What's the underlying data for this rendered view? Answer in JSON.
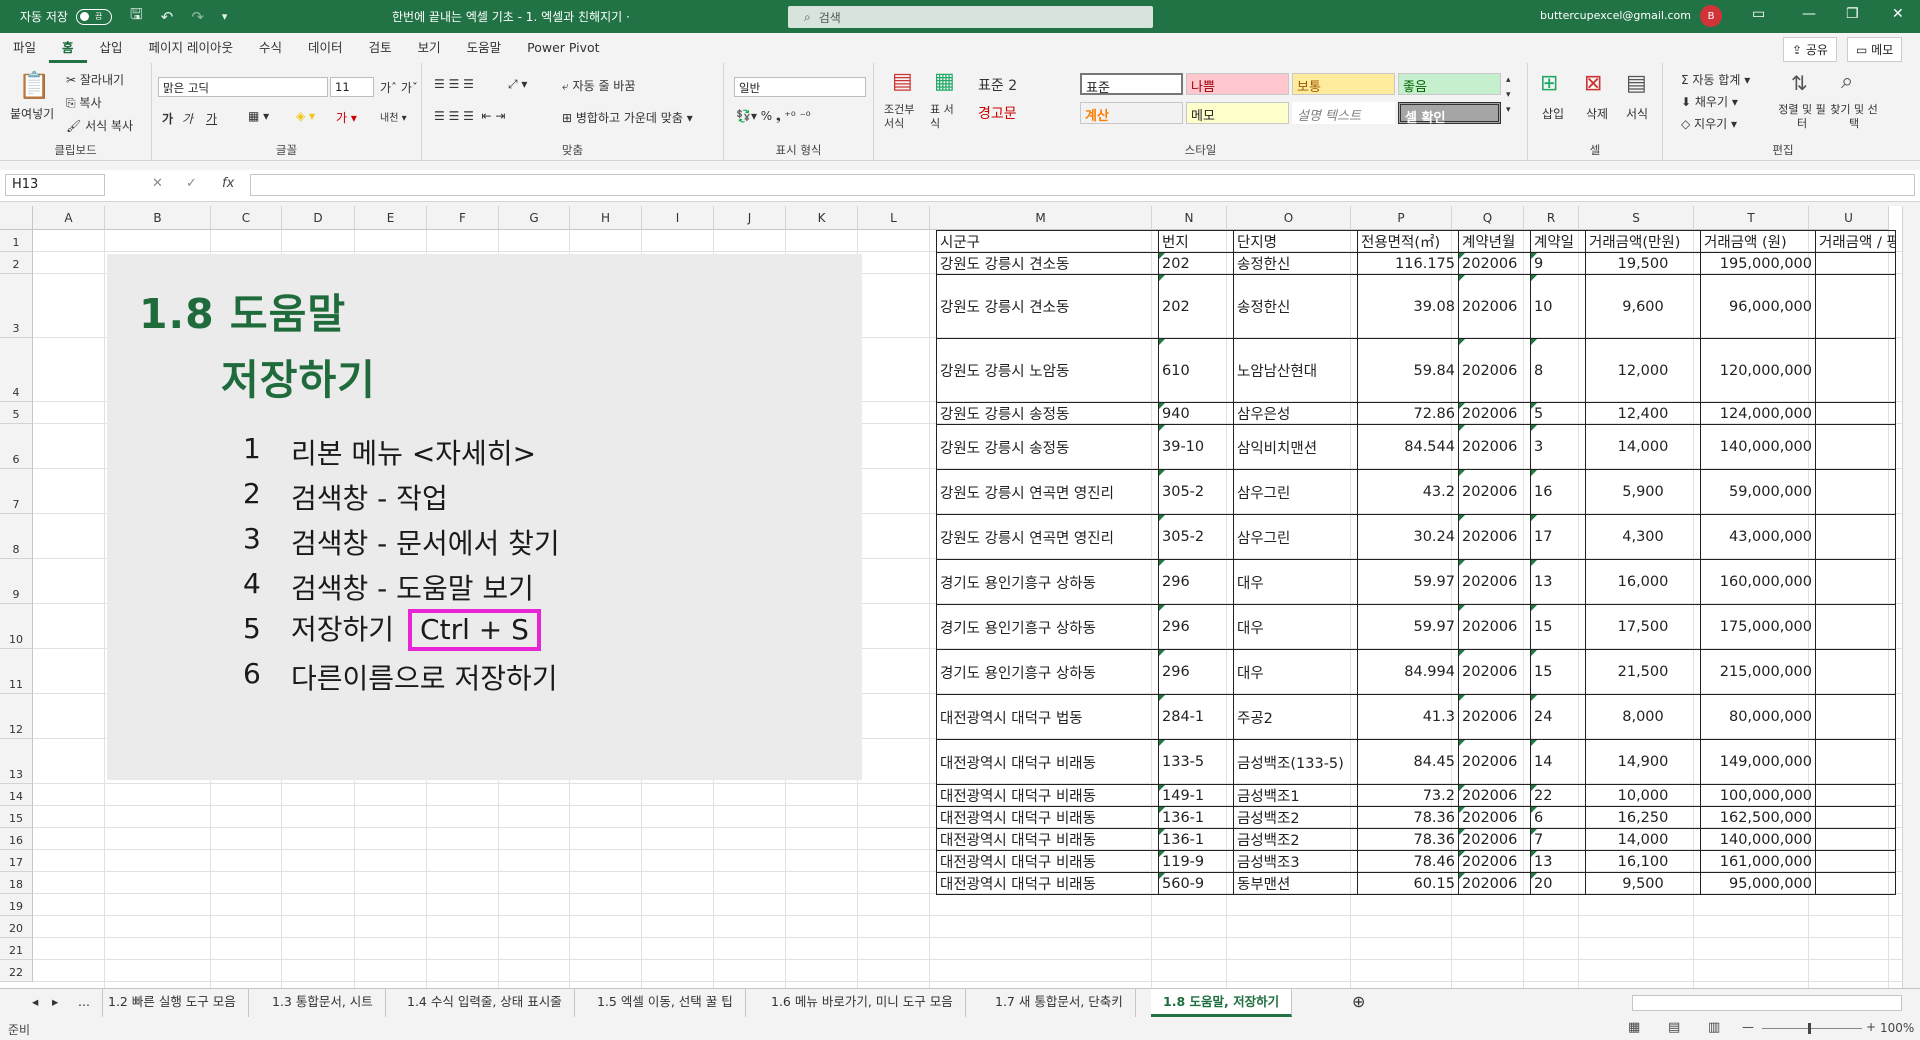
{
  "titlebar": {
    "autosave": "자동 저장",
    "toggle": "끔",
    "doc_title": "한번에 끝내는 엑셀 기초 - 1. 엑셀과 친해지기 ·",
    "search": "검색",
    "user": "buttercupexcel@gmail.com",
    "avatar": "B"
  },
  "tabs": [
    "파일",
    "홈",
    "삽입",
    "페이지 레이아웃",
    "수식",
    "데이터",
    "검토",
    "보기",
    "도움말",
    "Power Pivot"
  ],
  "share": "공유",
  "memo": "메모",
  "ribbon": {
    "paste": "붙여넣기",
    "cut": "잘라내기",
    "copy": "복사",
    "format_painter": "서식 복사",
    "clipboard": "클립보드",
    "font_name": "맑은 고딕",
    "font_size": "11",
    "font": "글꼴",
    "wrap": "자동 줄 바꿈",
    "merge": "병합하고 가운데 맞춤",
    "align": "맞춤",
    "number_format": "일반",
    "number": "표시 형식",
    "cond_format": "조건부 서식",
    "table_format": "표 서식",
    "styles": {
      "normal2": "표준 2",
      "warn": "경고문",
      "normal": "표준",
      "bad": "나쁨",
      "neutral": "보통",
      "good": "좋음",
      "calc": "계산",
      "note": "메모",
      "explain": "설명 텍스트",
      "check": "셀 확인"
    },
    "style": "스타일",
    "insert": "삽입",
    "delete": "삭제",
    "format": "서식",
    "cells": "셀",
    "autosum": "자동 합계",
    "fill": "채우기",
    "clear": "지우기",
    "sort": "정렬 및 필터",
    "find": "찾기 및 선택",
    "edit": "편집"
  },
  "namebox": "H13",
  "columns": [
    "A",
    "B",
    "C",
    "D",
    "E",
    "F",
    "G",
    "H",
    "I",
    "J",
    "K",
    "L",
    "M",
    "N",
    "O",
    "P",
    "Q",
    "R",
    "S",
    "T",
    "U"
  ],
  "rows": [
    "1",
    "2",
    "3",
    "4",
    "5",
    "6",
    "7",
    "8",
    "9",
    "10",
    "11",
    "12",
    "13",
    "14",
    "15",
    "16",
    "17",
    "18",
    "19",
    "20",
    "21",
    "22"
  ],
  "panel": {
    "title1": "1.8 도움말",
    "title2": "저장하기",
    "items": [
      {
        "n": "1",
        "t": "리본 메뉴 <자세히>"
      },
      {
        "n": "2",
        "t": "검색창 - 작업"
      },
      {
        "n": "3",
        "t": "검색창 - 문서에서 찾기"
      },
      {
        "n": "4",
        "t": "검색창 - 도움말 보기"
      },
      {
        "n": "5",
        "t": "저장하기"
      },
      {
        "n": "6",
        "t": "다른이름으로 저장하기"
      }
    ],
    "shortcut": "Ctrl + S"
  },
  "table": {
    "headers": [
      "시군구",
      "번지",
      "단지명",
      "전용면적(㎡)",
      "계약년월",
      "계약일",
      "거래금액(만원)",
      "거래금액 (원)",
      "거래금액 / 평"
    ],
    "rows": [
      [
        "강원도 강릉시 견소동",
        "202",
        "송정한신",
        "116.175",
        "202006",
        "9",
        "19,500",
        "195,000,000"
      ],
      [
        "강원도 강릉시 견소동",
        "202",
        "송정한신",
        "39.08",
        "202006",
        "10",
        "9,600",
        "96,000,000"
      ],
      [
        "강원도 강릉시 노암동",
        "610",
        "노암남산현대",
        "59.84",
        "202006",
        "8",
        "12,000",
        "120,000,000"
      ],
      [
        "강원도 강릉시 송정동",
        "940",
        "삼우은성",
        "72.86",
        "202006",
        "5",
        "12,400",
        "124,000,000"
      ],
      [
        "강원도 강릉시 송정동",
        "39-10",
        "삼익비치맨션",
        "84.544",
        "202006",
        "3",
        "14,000",
        "140,000,000"
      ],
      [
        "강원도 강릉시 연곡면 영진리",
        "305-2",
        "삼우그린",
        "43.2",
        "202006",
        "16",
        "5,900",
        "59,000,000"
      ],
      [
        "강원도 강릉시 연곡면 영진리",
        "305-2",
        "삼우그린",
        "30.24",
        "202006",
        "17",
        "4,300",
        "43,000,000"
      ],
      [
        "경기도 용인기흥구 상하동",
        "296",
        "대우",
        "59.97",
        "202006",
        "13",
        "16,000",
        "160,000,000"
      ],
      [
        "경기도 용인기흥구 상하동",
        "296",
        "대우",
        "59.97",
        "202006",
        "15",
        "17,500",
        "175,000,000"
      ],
      [
        "경기도 용인기흥구 상하동",
        "296",
        "대우",
        "84.994",
        "202006",
        "15",
        "21,500",
        "215,000,000"
      ],
      [
        "대전광역시 대덕구 법동",
        "284-1",
        "주공2",
        "41.3",
        "202006",
        "24",
        "8,000",
        "80,000,000"
      ],
      [
        "대전광역시 대덕구 비래동",
        "133-5",
        "금성백조(133-5)",
        "84.45",
        "202006",
        "14",
        "14,900",
        "149,000,000"
      ],
      [
        "대전광역시 대덕구 비래동",
        "149-1",
        "금성백조1",
        "73.2",
        "202006",
        "22",
        "10,000",
        "100,000,000"
      ],
      [
        "대전광역시 대덕구 비래동",
        "136-1",
        "금성백조2",
        "78.36",
        "202006",
        "6",
        "16,250",
        "162,500,000"
      ],
      [
        "대전광역시 대덕구 비래동",
        "136-1",
        "금성백조2",
        "78.36",
        "202006",
        "7",
        "14,000",
        "140,000,000"
      ],
      [
        "대전광역시 대덕구 비래동",
        "119-9",
        "금성백조3",
        "78.46",
        "202006",
        "13",
        "16,100",
        "161,000,000"
      ],
      [
        "대전광역시 대덕구 비래동",
        "560-9",
        "동부맨션",
        "60.15",
        "202006",
        "20",
        "9,500",
        "95,000,000"
      ]
    ]
  },
  "sheet_tabs": [
    "...",
    "1.2 빠른 실행 도구 모음",
    "1.3 통합문서, 시트",
    "1.4 수식 입력줄, 상태 표시줄",
    "1.5 엑셀 이동, 선택 꿀 팁",
    "1.6 메뉴 바로가기, 미니 도구 모음",
    "1.7 새 통합문서, 단축키",
    "1.8 도움말, 저장하기"
  ],
  "status": "준비",
  "zoom": "100%"
}
